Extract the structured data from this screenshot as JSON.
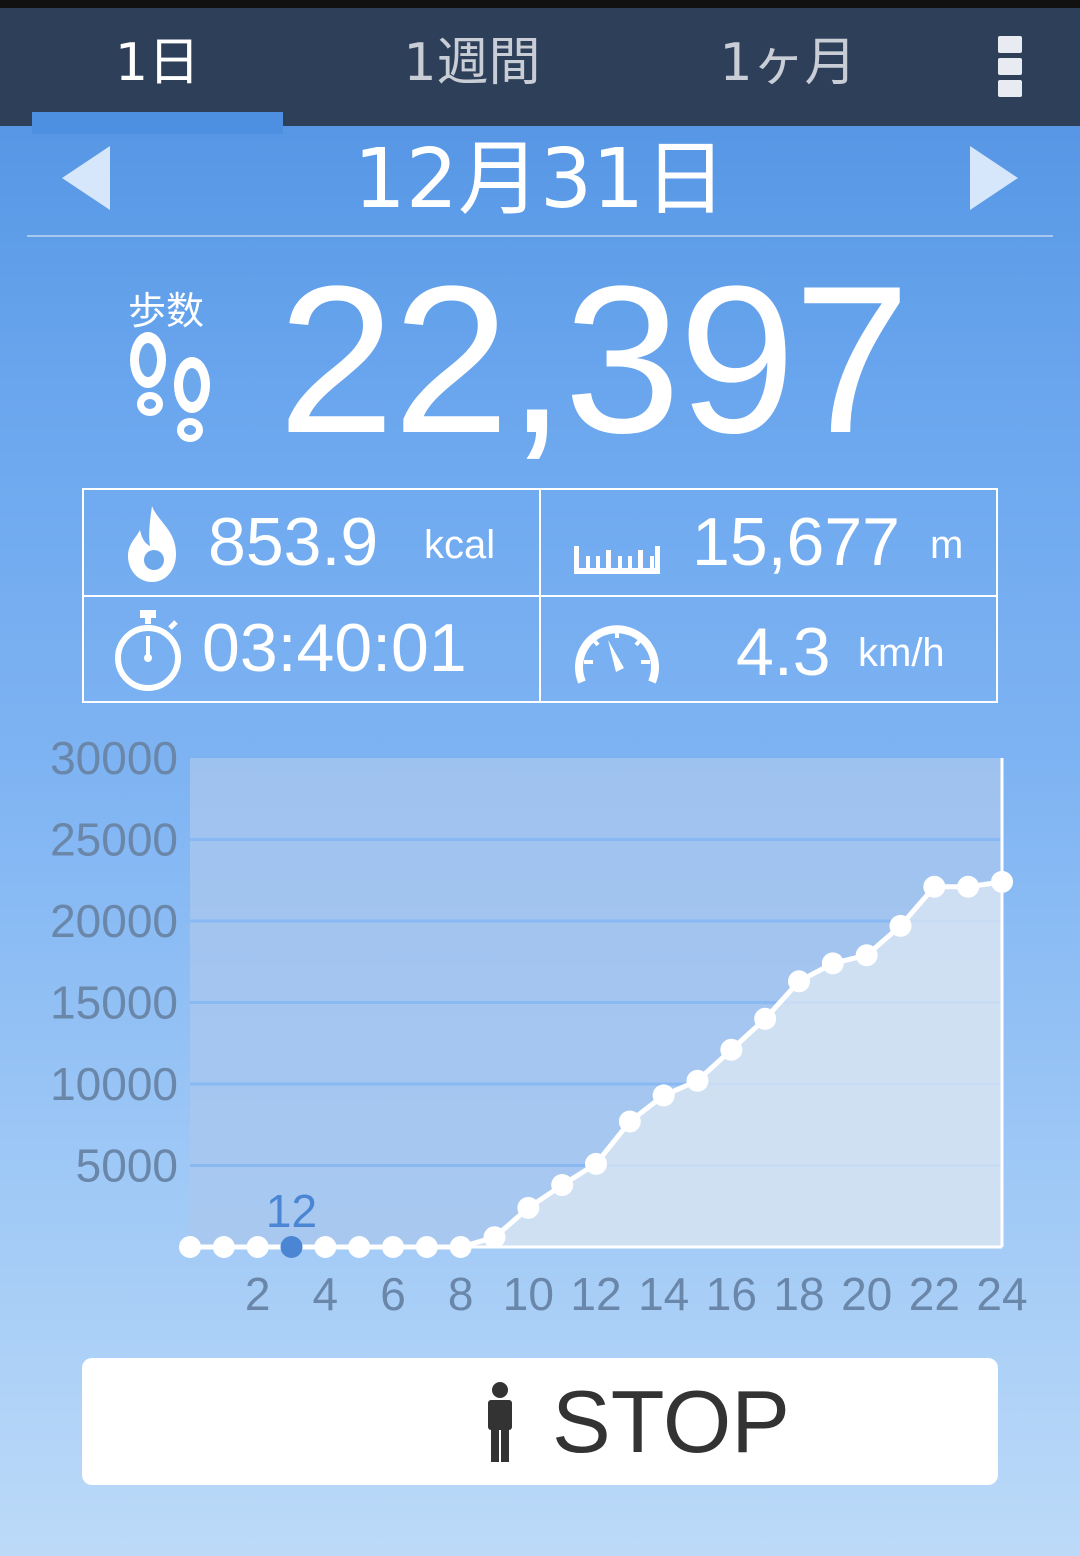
{
  "tabs": [
    {
      "label": "1日",
      "active": true
    },
    {
      "label": "1週間",
      "active": false
    },
    {
      "label": "1ヶ月",
      "active": false
    }
  ],
  "icons": {
    "menu": "more-vert-icon",
    "prev": "arrow-left-icon",
    "next": "arrow-right-icon",
    "steps": "footprints-icon",
    "calories": "flame-icon",
    "distance": "ruler-icon",
    "time": "stopwatch-icon",
    "speed": "speedometer-icon",
    "stop": "person-icon"
  },
  "date": "12月31日",
  "steps": {
    "label": "歩数",
    "value": "22,397"
  },
  "stats": {
    "calories": {
      "value": "853.9",
      "unit": "kcal"
    },
    "distance": {
      "value": "15,677",
      "unit": "m"
    },
    "time": {
      "value": "03:40:01"
    },
    "speed": {
      "value": "4.3",
      "unit": "km/h"
    }
  },
  "chart_data": {
    "type": "line",
    "ylim": [
      0,
      30000
    ],
    "y_ticks": [
      "30000",
      "25000",
      "20000",
      "15000",
      "10000",
      "5000"
    ],
    "x_ticks": [
      "2",
      "4",
      "6",
      "8",
      "10",
      "12",
      "14",
      "16",
      "18",
      "20",
      "22",
      "24"
    ],
    "x": [
      0,
      1,
      2,
      3,
      4,
      5,
      6,
      7,
      8,
      9,
      10,
      11,
      12,
      13,
      14,
      15,
      16,
      17,
      18,
      19,
      20,
      21,
      22,
      23,
      24
    ],
    "values": [
      0,
      0,
      0,
      0,
      0,
      0,
      0,
      0,
      0,
      600,
      2400,
      3800,
      5100,
      7700,
      9300,
      10200,
      12100,
      14000,
      16300,
      17400,
      17900,
      19700,
      22100,
      22100,
      22400
    ],
    "highlight": {
      "index": 3,
      "label": "12"
    },
    "colors": {
      "line": "#ffffff",
      "highlight": "#4a86d4",
      "area": "#dde8f4"
    }
  },
  "stop_button": {
    "label": "STOP"
  }
}
